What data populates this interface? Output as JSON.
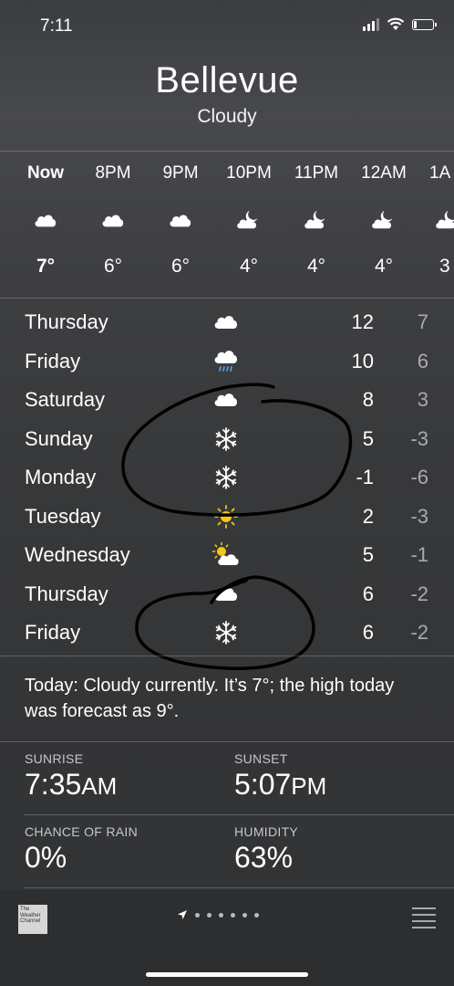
{
  "status": {
    "time": "7:11"
  },
  "header": {
    "city": "Bellevue",
    "condition": "Cloudy"
  },
  "hourly": [
    {
      "time": "Now",
      "icon": "cloud-icon",
      "temp": "7°"
    },
    {
      "time": "8PM",
      "icon": "cloud-icon",
      "temp": "6°"
    },
    {
      "time": "9PM",
      "icon": "cloud-icon",
      "temp": "6°"
    },
    {
      "time": "10PM",
      "icon": "cloudy-night-icon",
      "temp": "4°"
    },
    {
      "time": "11PM",
      "icon": "cloudy-night-icon",
      "temp": "4°"
    },
    {
      "time": "12AM",
      "icon": "cloudy-night-icon",
      "temp": "4°"
    },
    {
      "time": "1A",
      "icon": "cloudy-night-icon",
      "temp": "3"
    }
  ],
  "daily": [
    {
      "day": "Thursday",
      "icon": "cloud-icon",
      "high": "12",
      "low": "7"
    },
    {
      "day": "Friday",
      "icon": "rain-icon",
      "high": "10",
      "low": "6"
    },
    {
      "day": "Saturday",
      "icon": "cloud-icon",
      "high": "8",
      "low": "3"
    },
    {
      "day": "Sunday",
      "icon": "snowflake-icon",
      "high": "5",
      "low": "-3"
    },
    {
      "day": "Monday",
      "icon": "snowflake-icon",
      "high": "-1",
      "low": "-6"
    },
    {
      "day": "Tuesday",
      "icon": "sun-icon",
      "high": "2",
      "low": "-3"
    },
    {
      "day": "Wednesday",
      "icon": "partly-sunny-icon",
      "high": "5",
      "low": "-1"
    },
    {
      "day": "Thursday",
      "icon": "cloud-icon",
      "high": "6",
      "low": "-2"
    },
    {
      "day": "Friday",
      "icon": "snowflake-icon",
      "high": "6",
      "low": "-2"
    }
  ],
  "summary": "Today: Cloudy currently. It’s 7°; the high today was forecast as 9°.",
  "details": {
    "sunrise_label": "SUNRISE",
    "sunrise_value": "7:35",
    "sunrise_suffix": "AM",
    "sunset_label": "SUNSET",
    "sunset_value": "5:07",
    "sunset_suffix": "PM",
    "rain_label": "CHANCE OF RAIN",
    "rain_value": "0%",
    "humidity_label": "HUMIDITY",
    "humidity_value": "63%"
  },
  "footer": {
    "logo_text": "The Weather Channel"
  },
  "colors": {
    "text": "#ffffff",
    "secondary_text": "#a9aaac",
    "sun": "#f5c518",
    "annotation": "#000000"
  }
}
